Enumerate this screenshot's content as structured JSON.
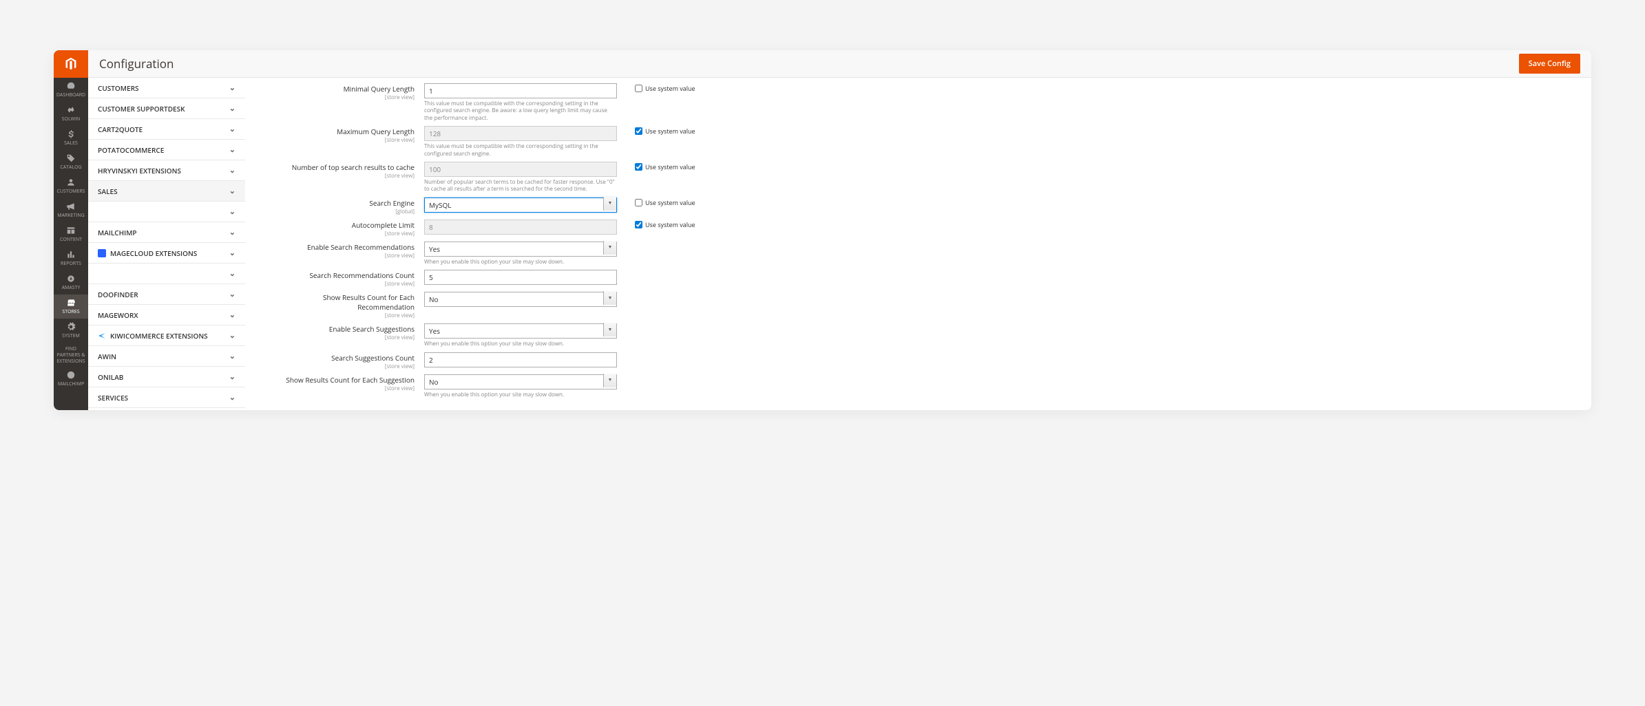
{
  "page_title": "Configuration",
  "save_button": "Save Config",
  "nav": [
    {
      "icon": "dashboard",
      "label": "DASHBOARD"
    },
    {
      "icon": "solwin",
      "label": "SOLWIN"
    },
    {
      "icon": "dollar",
      "label": "SALES"
    },
    {
      "icon": "tag",
      "label": "CATALOG"
    },
    {
      "icon": "person",
      "label": "CUSTOMERS"
    },
    {
      "icon": "bullhorn",
      "label": "MARKETING"
    },
    {
      "icon": "content",
      "label": "CONTENT"
    },
    {
      "icon": "bars",
      "label": "REPORTS"
    },
    {
      "icon": "amasty",
      "label": "AMASTY"
    },
    {
      "icon": "stores",
      "label": "STORES",
      "active": true
    },
    {
      "icon": "gear",
      "label": "SYSTEM"
    },
    {
      "icon": "partners",
      "label": "FIND PARTNERS & EXTENSIONS"
    },
    {
      "icon": "mailchimp",
      "label": "MAILCHIMP"
    }
  ],
  "config_sections": [
    {
      "label": "CUSTOMERS"
    },
    {
      "label": "CUSTOMER SUPPORTDESK"
    },
    {
      "label": "CART2QUOTE"
    },
    {
      "label": "POTATOCOMMERCE"
    },
    {
      "label": "HRYVINSKYI EXTENSIONS"
    },
    {
      "label": "SALES",
      "selected": true
    },
    {
      "label": ""
    },
    {
      "label": "MAILCHIMP"
    },
    {
      "label": "MAGECLOUD EXTENSIONS",
      "icon": "mc"
    },
    {
      "label": ""
    },
    {
      "label": "DOOFINDER"
    },
    {
      "label": "MAGEWORX"
    },
    {
      "label": "KIWICOMMERCE EXTENSIONS",
      "icon": "kc"
    },
    {
      "label": "AWIN"
    },
    {
      "label": "ONILAB"
    },
    {
      "label": "SERVICES"
    }
  ],
  "use_system_label": "Use system value",
  "fields": {
    "min_query": {
      "label": "Minimal Query Length",
      "scope": "[store view]",
      "value": "1",
      "hint": "This value must be compatible with the corresponding setting in the configured search engine. Be aware: a low query length limit may cause the performance impact.",
      "use_system": false,
      "disabled": false
    },
    "max_query": {
      "label": "Maximum Query Length",
      "scope": "[store view]",
      "value": "128",
      "hint": "This value must be compatible with the corresponding setting in the configured search engine.",
      "use_system": true,
      "disabled": true
    },
    "cache_results": {
      "label": "Number of top search results to cache",
      "scope": "[store view]",
      "value": "100",
      "hint": "Number of popular search terms to be cached for faster response. Use \"0\" to cache all results after a term is searched for the second time.",
      "use_system": true,
      "disabled": true
    },
    "engine": {
      "label": "Search Engine",
      "scope": "[global]",
      "value": "MySQL",
      "use_system": false,
      "highlight": true
    },
    "autocomplete": {
      "label": "Autocomplete Limit",
      "scope": "[store view]",
      "value": "8",
      "use_system": true,
      "disabled": true
    },
    "enable_recs": {
      "label": "Enable Search Recommendations",
      "scope": "[store view]",
      "value": "Yes",
      "hint": "When you enable this option your site may slow down."
    },
    "recs_count": {
      "label": "Search Recommendations Count",
      "scope": "[store view]",
      "value": "5"
    },
    "show_recs_count": {
      "label": "Show Results Count for Each Recommendation",
      "scope": "[store view]",
      "value": "No"
    },
    "enable_sugg": {
      "label": "Enable Search Suggestions",
      "scope": "[store view]",
      "value": "Yes",
      "hint": "When you enable this option your site may slow down."
    },
    "sugg_count": {
      "label": "Search Suggestions Count",
      "scope": "[store view]",
      "value": "2"
    },
    "show_sugg_count": {
      "label": "Show Results Count for Each Suggestion",
      "scope": "[store view]",
      "value": "No",
      "hint": "When you enable this option your site may slow down."
    }
  }
}
